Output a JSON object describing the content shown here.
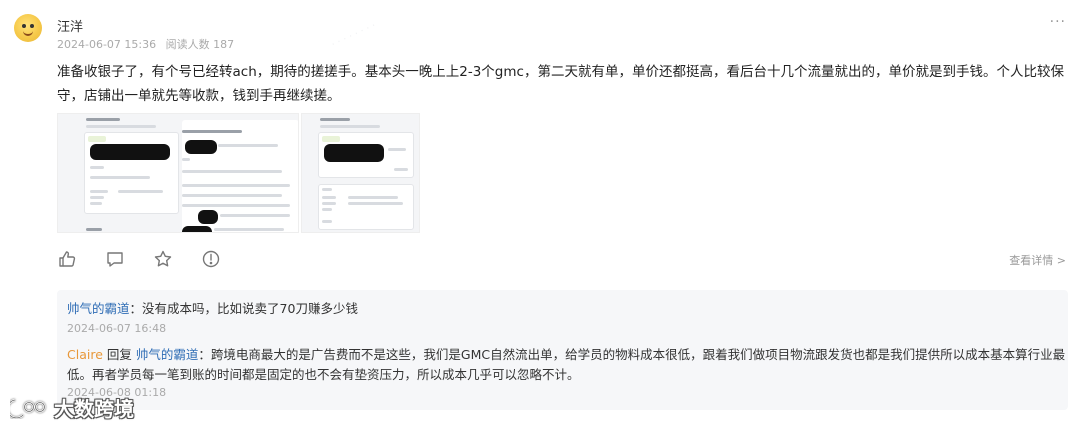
{
  "post": {
    "author": "汪洋",
    "date": "2024-06-07 15:36",
    "reads": "阅读人数 187",
    "more": "···",
    "text": "准备收银子了，有个号已经转ach，期待的搓搓手。基本头一晚上上2-3个gmc，第二天就有单，单价还都挺高，看后台十几个流量就出的，单价就是到手钱。个人比较保守，店铺出一单就先等收款，钱到手再继续搓。",
    "detail_link": "查看详情 >"
  },
  "actions": [
    {
      "icon": "thumbs-up-icon"
    },
    {
      "icon": "comment-icon"
    },
    {
      "icon": "star-icon"
    },
    {
      "icon": "alert-icon"
    }
  ],
  "comments": [
    {
      "author": "帅气的霸道",
      "sep": "：",
      "text": "没有成本吗，比如说卖了70刀赚多少钱",
      "time": "2024-06-07 16:48"
    },
    {
      "author": "Claire",
      "reply_word": "回复",
      "reply_to": "帅气的霸道",
      "sep": "：",
      "text": "跨境电商最大的是广告费而不是这些，我们是GMC自然流出单，给学员的物料成本很低，跟着我们做项目物流跟发货也都是我们提供所以成本基本算行业最低。再者学员每一笔到账的时间都是固定的也不会有垫资压力，所以成本几乎可以忽略不计。",
      "time": "2024-06-08 01:18"
    }
  ],
  "brand": {
    "name": "大数跨境"
  },
  "colors": {
    "link": "#2f6db5",
    "reply_author": "#e8983a",
    "meta": "#aaaaaa"
  }
}
